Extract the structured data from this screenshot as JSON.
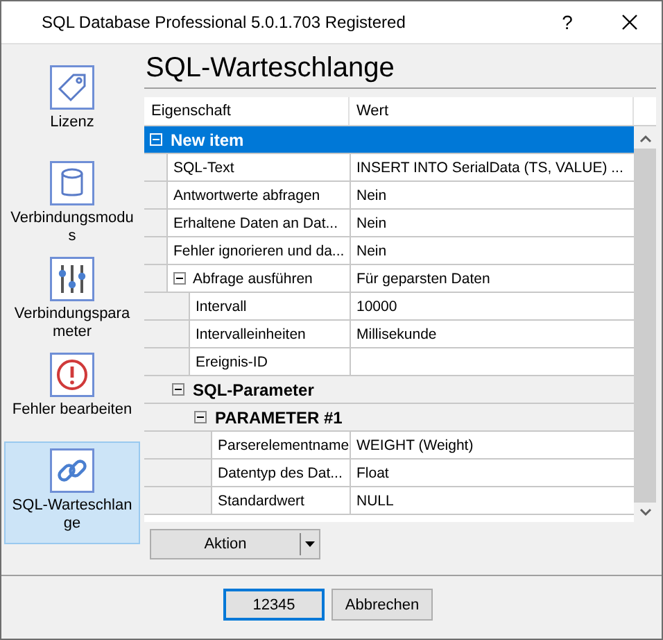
{
  "window": {
    "title": "SQL Database Professional 5.0.1.703 Registered",
    "help": "?"
  },
  "sidebar": {
    "items": [
      {
        "label": "Lizenz",
        "selected": false
      },
      {
        "label": "Verbindungsmodus",
        "selected": false
      },
      {
        "label": "Verbindungsparameter",
        "selected": false
      },
      {
        "label": "Fehler bearbeiten",
        "selected": false
      },
      {
        "label": "SQL-Warteschlange",
        "selected": true
      }
    ]
  },
  "heading": "SQL-Warteschlange",
  "grid": {
    "columns": [
      "Eigenschaft",
      "Wert"
    ],
    "rows": [
      {
        "kind": "category",
        "name": "New item",
        "expanded": true,
        "selected": true,
        "children": [
          {
            "kind": "property",
            "name": "SQL-Text",
            "value": "INSERT INTO SerialData (TS, VALUE) ...",
            "selected": false
          },
          {
            "kind": "property",
            "name": "Antwortwerte abfragen",
            "value": "Nein",
            "selected": false
          },
          {
            "kind": "property",
            "name": "Erhaltene Daten an Dat...",
            "value": "Nein",
            "selected": false
          },
          {
            "kind": "property",
            "name": "Fehler ignorieren und da...",
            "value": "Nein",
            "selected": false
          },
          {
            "kind": "property",
            "name": "Abfrage ausführen",
            "value": "Für geparsten Daten",
            "expanded": true,
            "selected": false,
            "children": [
              {
                "kind": "property",
                "name": "Intervall",
                "value": "10000",
                "selected": false
              },
              {
                "kind": "property",
                "name": "Intervalleinheiten",
                "value": "Millisekunde",
                "selected": false
              },
              {
                "kind": "property",
                "name": "Ereignis-ID",
                "selected": false
              }
            ]
          },
          {
            "kind": "category",
            "name": "SQL-Parameter",
            "expanded": true,
            "selected": false,
            "children": [
              {
                "kind": "category",
                "name": "PARAMETER #1",
                "expanded": true,
                "selected": false,
                "children": [
                  {
                    "kind": "property",
                    "name": "Parserelementname",
                    "value": "WEIGHT (Weight)",
                    "selected": false
                  },
                  {
                    "kind": "property",
                    "name": "Datentyp des Dat...",
                    "value": "Float",
                    "selected": false
                  },
                  {
                    "kind": "property",
                    "name": "Standardwert",
                    "value": "NULL",
                    "selected": false
                  }
                ]
              }
            ]
          }
        ]
      }
    ]
  },
  "action_button": "Aktion",
  "buttons": [
    {
      "label": "12345",
      "default": true
    },
    {
      "label": "Abbrechen",
      "default": false
    }
  ]
}
